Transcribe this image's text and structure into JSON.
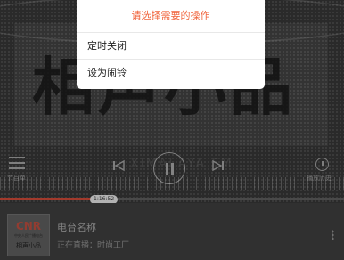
{
  "background": {
    "logo_text": "相声小品",
    "watermark": "XIMALAYA FM",
    "controls": {
      "playlist_label": "节目单",
      "history_label": "播放历史"
    },
    "progress": {
      "time": "1:16:52",
      "played_fraction": 0.3
    },
    "station": {
      "logo_main": "CNR",
      "logo_sub": "中央人民广播电台",
      "logo_name": "相声小品",
      "name": "电台名称",
      "live_text": "正在直播：时尚工厂"
    }
  },
  "popup": {
    "title": "请选择需要的操作",
    "items": [
      {
        "label": "定时关闭"
      },
      {
        "label": "设为闹铃"
      }
    ]
  },
  "colors": {
    "accent": "#f0643c",
    "progress": "#c64736"
  }
}
